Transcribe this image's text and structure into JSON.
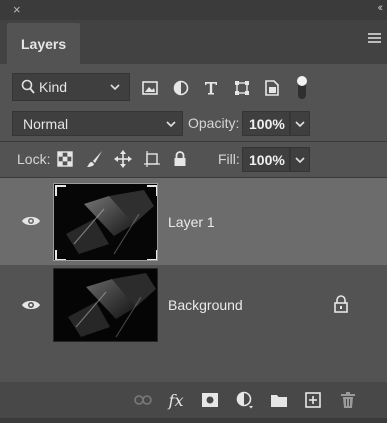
{
  "window": {
    "close_glyph": "×",
    "collapse_glyph": "‹‹"
  },
  "panel": {
    "tab_label": "Layers"
  },
  "filter": {
    "kind_label": "Kind",
    "icons": [
      "pixel-filter-icon",
      "adjustment-filter-icon",
      "type-filter-icon",
      "shape-filter-icon",
      "smart-object-filter-icon",
      "filter-toggle-icon"
    ]
  },
  "blend": {
    "mode": "Normal",
    "opacity_label": "Opacity:",
    "opacity_value": "100%"
  },
  "lock": {
    "label": "Lock:",
    "icons": [
      "lock-transparent-pixels-icon",
      "lock-image-pixels-icon",
      "lock-position-icon",
      "lock-artboard-icon",
      "lock-all-icon"
    ],
    "fill_label": "Fill:",
    "fill_value": "100%"
  },
  "layers": [
    {
      "name": "Layer 1",
      "visible": true,
      "selected": true,
      "locked": false
    },
    {
      "name": "Background",
      "visible": true,
      "selected": false,
      "locked": true
    }
  ],
  "footer": {
    "icons": [
      "link-layers-icon",
      "fx-icon",
      "add-mask-icon",
      "new-adjustment-icon",
      "new-group-icon",
      "new-layer-icon",
      "delete-layer-icon"
    ],
    "fx_label": "fx"
  },
  "colors": {
    "panel_bg": "#535353",
    "selected_row": "#6c6c6c",
    "field_bg": "#3f3f3f"
  }
}
